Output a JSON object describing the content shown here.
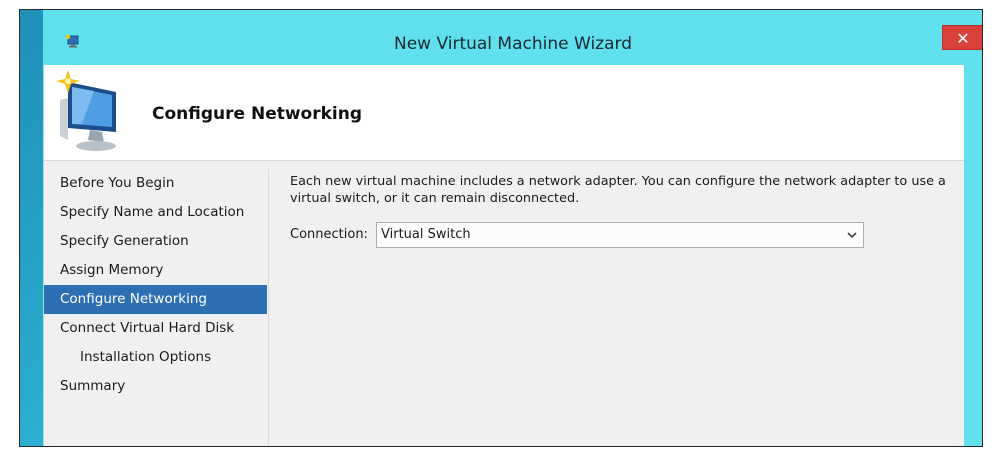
{
  "window": {
    "title": "New Virtual Machine Wizard",
    "close_label": "✕"
  },
  "header": {
    "title": "Configure Networking"
  },
  "steps": [
    {
      "label": "Before You Begin"
    },
    {
      "label": "Specify Name and Location"
    },
    {
      "label": "Specify Generation"
    },
    {
      "label": "Assign Memory"
    },
    {
      "label": "Configure Networking",
      "active": true
    },
    {
      "label": "Connect Virtual Hard Disk"
    },
    {
      "label": "Installation Options",
      "sub": true
    },
    {
      "label": "Summary"
    }
  ],
  "content": {
    "description": "Each new virtual machine includes a network adapter. You can configure the network adapter to use a virtual switch, or it can remain disconnected.",
    "connection_label": "Connection:",
    "connection_value": "Virtual Switch"
  },
  "colors": {
    "titlebar": "#5fe0ec",
    "close_button": "#d9413a",
    "selected_step": "#2d6fb3"
  },
  "icons": {
    "title_icon": "hyperv-vm-icon",
    "header_icon": "monitor-sparkle-icon",
    "dropdown_icon": "chevron-down-icon"
  }
}
